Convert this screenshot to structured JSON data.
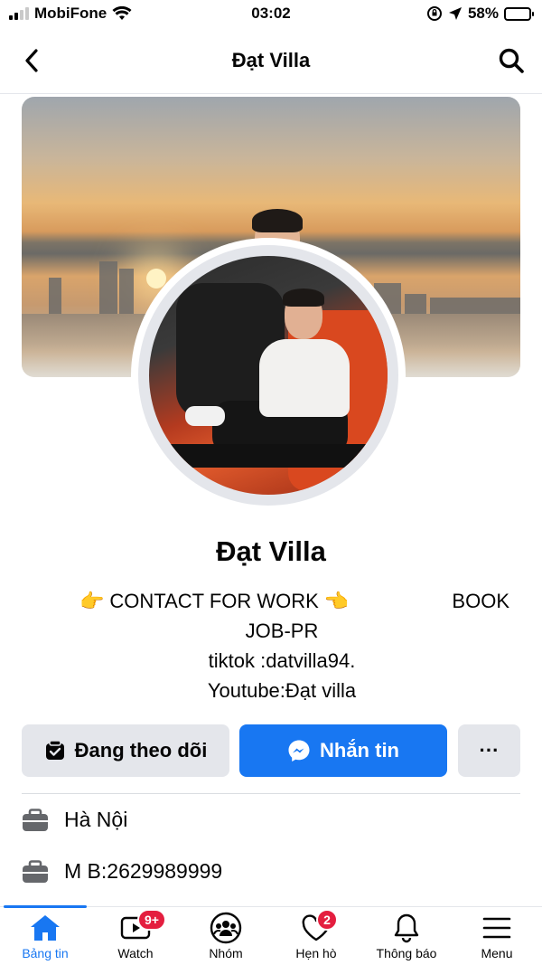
{
  "status_bar": {
    "carrier": "MobiFone",
    "time": "03:02",
    "battery": "58%",
    "battery_level": 0.58,
    "icons": [
      "signal-icon",
      "wifi-icon",
      "orientation-lock-icon",
      "location-arrow-icon",
      "battery-icon"
    ]
  },
  "header": {
    "title": "Đạt Villa",
    "icons": [
      "back-chevron-icon",
      "search-icon"
    ]
  },
  "profile": {
    "name": "Đạt Villa",
    "bio": {
      "contact": "CONTACT FOR WORK",
      "book": "BOOK",
      "line2": "JOB-PR",
      "line3": "tiktok :datvilla94.",
      "line4": "Youtube:Đạt villa"
    }
  },
  "actions": {
    "follow_label": "Đang theo dõi",
    "message_label": "Nhắn tin",
    "more_label": "···"
  },
  "details": [
    {
      "icon": "briefcase-icon",
      "text": "Hà Nội"
    },
    {
      "icon": "briefcase-icon",
      "text": "M B:2629989999"
    }
  ],
  "bottom_nav": {
    "items": [
      {
        "label": "Bảng tin",
        "icon": "home-icon",
        "active": true
      },
      {
        "label": "Watch",
        "icon": "video-icon",
        "badge": "9+"
      },
      {
        "label": "Nhóm",
        "icon": "groups-icon"
      },
      {
        "label": "Hẹn hò",
        "icon": "heart-icon",
        "badge": "2"
      },
      {
        "label": "Thông báo",
        "icon": "bell-icon"
      },
      {
        "label": "Menu",
        "icon": "menu-icon"
      }
    ]
  },
  "colors": {
    "accent": "#1877f2",
    "badge": "#e41e3f",
    "button_gray": "#e4e6eb"
  }
}
